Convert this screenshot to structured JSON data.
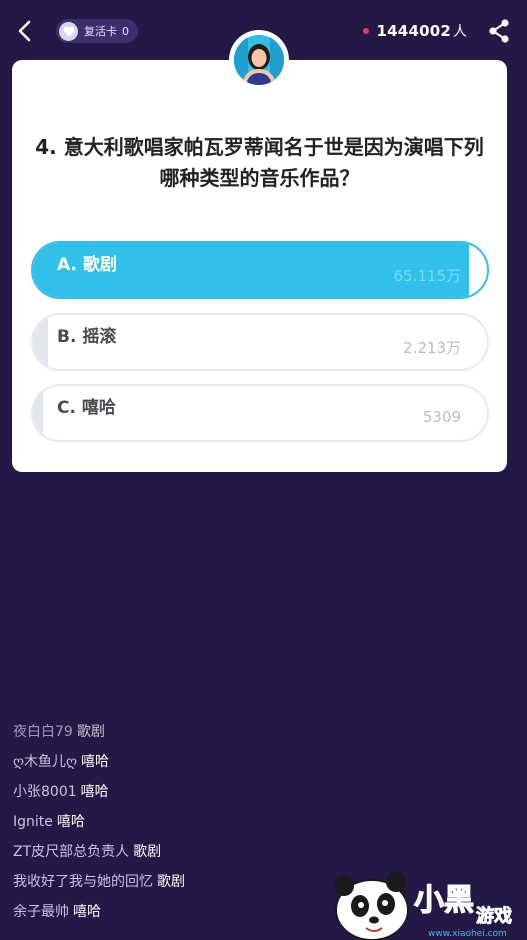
{
  "header": {
    "revive_card_label": "复活卡",
    "revive_card_count": "0",
    "online_count": "1444002",
    "online_unit": "人"
  },
  "question": {
    "text": "4. 意大利歌唱家帕瓦罗蒂闻名于世是因为演唱下列哪种类型的音乐作品？",
    "options": [
      {
        "label": "A. 歌剧",
        "count": "65.115万",
        "fill_fraction": 1.0,
        "selected": true
      },
      {
        "label": "B. 摇滚",
        "count": "2.213万",
        "fill_fraction": 0.034,
        "selected": false
      },
      {
        "label": "C. 嘻哈",
        "count": "5309",
        "fill_fraction": 0.008,
        "selected": false
      }
    ]
  },
  "chat": [
    {
      "user": "夜白白79",
      "msg": "歌剧"
    },
    {
      "user": "ღ木鱼儿ღ",
      "msg": "嘻哈"
    },
    {
      "user": "小张8001",
      "msg": "嘻哈"
    },
    {
      "user": "Ignite",
      "msg": "嘻哈"
    },
    {
      "user": "ZT皮尺部总负责人",
      "msg": "歌剧"
    },
    {
      "user": "我收好了我与她的回忆",
      "msg": "歌剧"
    },
    {
      "user": "余子最帅",
      "msg": "嘻哈"
    }
  ],
  "watermark": {
    "brand": "小黑游戏",
    "url": "www.xiaohei.com"
  },
  "colors": {
    "background": "#241846",
    "option_fill": "#30c0e9",
    "online_dot": "#e8386a"
  },
  "icons": {
    "back": "chevron-left-icon",
    "revive": "heart-icon",
    "share": "share-icon"
  }
}
